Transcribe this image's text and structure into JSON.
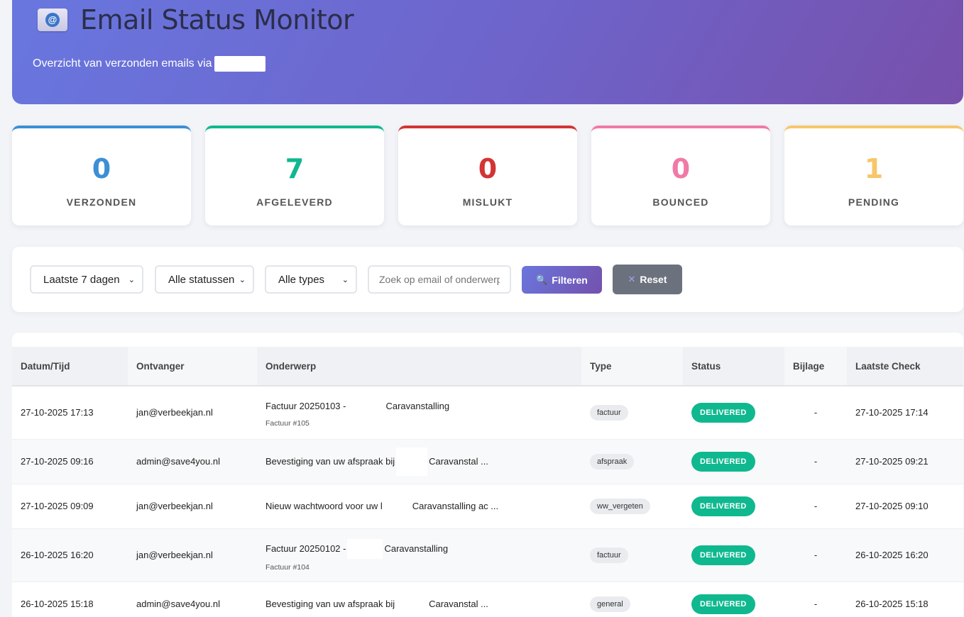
{
  "header": {
    "title": "Email Status Monitor",
    "subtitle": "Overzicht van verzonden emails via"
  },
  "stats": [
    {
      "value": "0",
      "label": "VERZONDEN",
      "color": "#3b8fd4"
    },
    {
      "value": "7",
      "label": "AFGELEVERD",
      "color": "#10b88f"
    },
    {
      "value": "0",
      "label": "MISLUKT",
      "color": "#d33435"
    },
    {
      "value": "0",
      "label": "BOUNCED",
      "color": "#f07aa6"
    },
    {
      "value": "1",
      "label": "PENDING",
      "color": "#f7c66a"
    }
  ],
  "filters": {
    "period": "Laatste 7 dagen",
    "status": "Alle statussen",
    "type": "Alle types",
    "search_placeholder": "Zoek op email of onderwerp",
    "filter_label": "Filteren",
    "reset_label": "Reset"
  },
  "table": {
    "headers": [
      "Datum/Tijd",
      "Ontvanger",
      "Onderwerp",
      "Type",
      "Status",
      "Bijlage",
      "Laatste Check"
    ],
    "rows": [
      {
        "date": "27-10-2025 17:13",
        "recipient": "jan@verbeekjan.nl",
        "subject_a": "Factuur 20250103 -",
        "subject_b": "Caravanstalling",
        "subject_sub": "Factuur #105",
        "type": "factuur",
        "status": "DELIVERED",
        "attachment": "-",
        "last_check": "27-10-2025 17:14"
      },
      {
        "date": "27-10-2025 09:16",
        "recipient": "admin@save4you.nl",
        "subject_a": "Bevestiging van uw afspraak bij",
        "subject_b": "Caravanstal ...",
        "subject_sub": "",
        "type": "afspraak",
        "status": "DELIVERED",
        "attachment": "-",
        "last_check": "27-10-2025 09:21"
      },
      {
        "date": "27-10-2025 09:09",
        "recipient": "jan@verbeekjan.nl",
        "subject_a": "Nieuw wachtwoord voor uw l",
        "subject_b": "Caravanstalling ac ...",
        "subject_sub": "",
        "type": "ww_vergeten",
        "status": "DELIVERED",
        "attachment": "-",
        "last_check": "27-10-2025 09:10"
      },
      {
        "date": "26-10-2025 16:20",
        "recipient": "jan@verbeekjan.nl",
        "subject_a": "Factuur 20250102 -",
        "subject_b": "Caravanstalling",
        "subject_sub": "Factuur #104",
        "type": "factuur",
        "status": "DELIVERED",
        "attachment": "-",
        "last_check": "26-10-2025 16:20"
      },
      {
        "date": "26-10-2025 15:18",
        "recipient": "admin@save4you.nl",
        "subject_a": "Bevestiging van uw afspraak bij",
        "subject_b": "Caravanstal ...",
        "subject_sub": "",
        "type": "general",
        "status": "DELIVERED",
        "attachment": "-",
        "last_check": "26-10-2025 15:18"
      }
    ]
  }
}
